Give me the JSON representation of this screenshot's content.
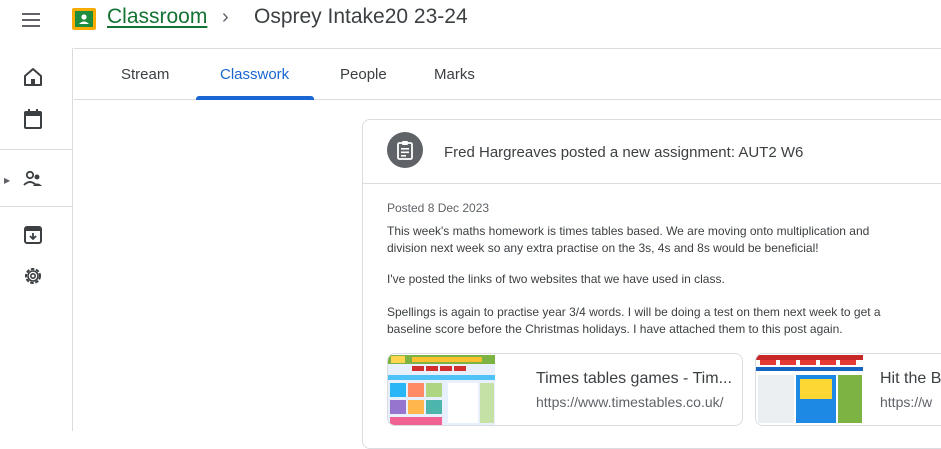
{
  "header": {
    "app_name": "Classroom",
    "separator": "›",
    "class_title": "Osprey Intake20 23-24"
  },
  "rail": {
    "items": [
      "home-icon",
      "calendar-icon",
      "enrolled-icon",
      "archive-icon",
      "settings-icon"
    ]
  },
  "tabs": {
    "stream": "Stream",
    "classwork": "Classwork",
    "people": "People",
    "marks": "Marks"
  },
  "post": {
    "heading": "Fred Hargreaves posted a new assignment: AUT2 W6",
    "posted": "Posted 8 Dec 2023",
    "p1_line1": "This week's maths homework is times tables based. We are moving onto multiplication and",
    "p1_line2": "division next week so any extra practise on the 3s, 4s and 8s would be beneficial!",
    "p2": "I've posted the links of two websites that we have used in class.",
    "p3_line1": "Spellings is again to practise year 3/4 words. I will be doing a test on them next week to get a",
    "p3_line2": "baseline score before the Christmas holidays. I have attached them to this post again.",
    "attachments": [
      {
        "title": "Times tables games - Tim...",
        "url": "https://www.timestables.co.uk/"
      },
      {
        "title": "Hit the B",
        "url": "https://w"
      }
    ]
  },
  "colors": {
    "brand_green": "#137333",
    "active_blue": "#1967d2",
    "avatar_grey": "#5f6368"
  }
}
